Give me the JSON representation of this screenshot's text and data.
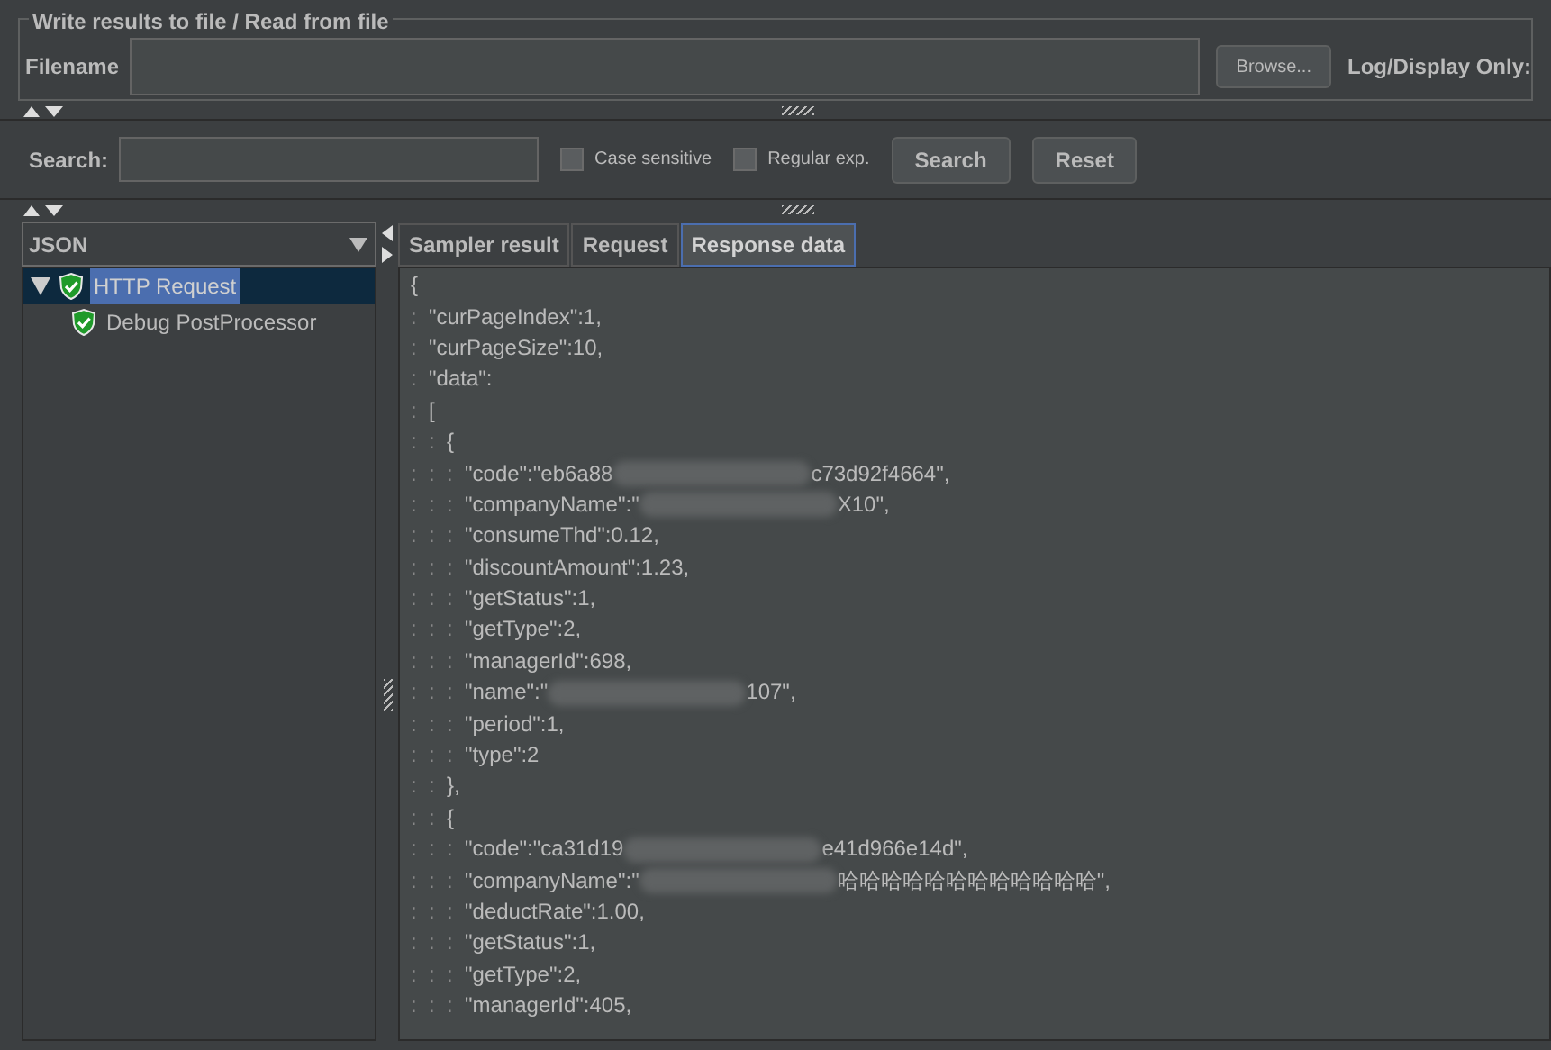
{
  "file_panel": {
    "title": "Write results to file / Read from file",
    "filename_label": "Filename",
    "browse_button": "Browse...",
    "log_label": "Log/Display Only:"
  },
  "search_bar": {
    "label": "Search:",
    "options": [
      {
        "label": "Case sensitive",
        "checked": false
      },
      {
        "label": "Regular exp.",
        "checked": false
      }
    ],
    "buttons": [
      "Search",
      "Reset"
    ]
  },
  "renderer": {
    "value": "JSON"
  },
  "tree": [
    {
      "label": "HTTP Request",
      "selected": true,
      "expanded": true,
      "children": [
        {
          "label": "Debug PostProcessor",
          "selected": false
        }
      ]
    }
  ],
  "tabs": [
    {
      "label": "Sampler result",
      "selected": false
    },
    {
      "label": "Request",
      "selected": false
    },
    {
      "label": "Response data",
      "selected": true
    }
  ],
  "response_lines": [
    {
      "text": "{"
    },
    {
      "guides": ":",
      "text": "\"curPageIndex\":1,"
    },
    {
      "guides": ":",
      "text": "\"curPageSize\":10,"
    },
    {
      "guides": ":",
      "text": "\"data\":"
    },
    {
      "guides": ":",
      "text": "["
    },
    {
      "guides": ":  :",
      "text": "{"
    },
    {
      "guides": ":  :  :",
      "text": "\"code\":\"eb6a88",
      "redacted": true,
      "text_after": "c73d92f4664\","
    },
    {
      "guides": ":  :  :",
      "text": "\"companyName\":\"",
      "redacted": true,
      "text_after": "X10\","
    },
    {
      "guides": ":  :  :",
      "text": "\"consumeThd\":0.12,"
    },
    {
      "guides": ":  :  :",
      "text": "\"discountAmount\":1.23,"
    },
    {
      "guides": ":  :  :",
      "text": "\"getStatus\":1,"
    },
    {
      "guides": ":  :  :",
      "text": "\"getType\":2,"
    },
    {
      "guides": ":  :  :",
      "text": "\"managerId\":698,"
    },
    {
      "guides": ":  :  :",
      "text": "\"name\":\"",
      "redacted": true,
      "text_after": "107\","
    },
    {
      "guides": ":  :  :",
      "text": "\"period\":1,"
    },
    {
      "guides": ":  :  :",
      "text": "\"type\":2"
    },
    {
      "guides": ":  :",
      "text": "},"
    },
    {
      "guides": ":  :",
      "text": "{"
    },
    {
      "guides": ":  :  :",
      "text": "\"code\":\"ca31d19",
      "redacted": true,
      "text_after": "e41d966e14d\","
    },
    {
      "guides": ":  :  :",
      "text": "\"companyName\":\"",
      "redacted": true,
      "text_after": "哈哈哈哈哈哈哈哈哈哈哈哈\","
    },
    {
      "guides": ":  :  :",
      "text": "\"deductRate\":1.00,"
    },
    {
      "guides": ":  :  :",
      "text": "\"getStatus\":1,"
    },
    {
      "guides": ":  :  :",
      "text": "\"getType\":2,"
    },
    {
      "guides": ":  :  :",
      "text": "\"managerId\":405,"
    }
  ]
}
